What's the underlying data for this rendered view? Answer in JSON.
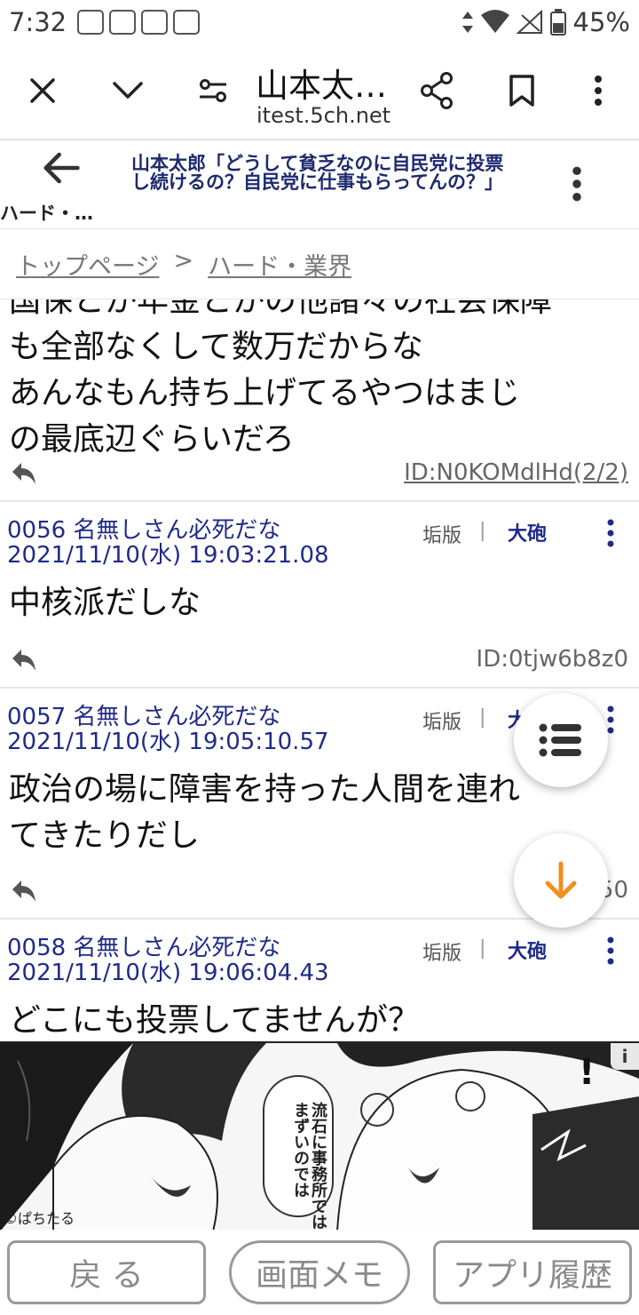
{
  "status_bar": {
    "time": "7:32",
    "battery": "45%"
  },
  "browser": {
    "title": "山本太…",
    "url": "itest.5ch.net"
  },
  "thread_header": {
    "back_label": "ハード・…",
    "title": "山本太郎「どうして貧乏なのに自民党に投票し続けるの？自民党に仕事もらってんの？」"
  },
  "breadcrumb": {
    "top": "トップページ",
    "separator": ">",
    "board": "ハード・業界"
  },
  "posts": [
    {
      "lines": [
        "国保とか年金とかの他諸々の社会保障",
        "も全部なくして数万だからな",
        "あんなもん持ち上げてるやつはまじ",
        "の最底辺ぐらいだろ"
      ],
      "id": "ID:N0KOMdlHd(2/2)"
    },
    {
      "header": "0056 名無しさん必死だな 2021/11/10(水) 19:03:21.08",
      "board": "垢版",
      "separator": "|",
      "tag": "大砲",
      "lines": [
        "中核派だしな"
      ],
      "id": "ID:0tjw6b8z0"
    },
    {
      "header": "0057 名無しさん必死だな 2021/11/10(水) 19:05:10.57",
      "board": "垢版",
      "separator": "|",
      "tag": "大砲",
      "lines": [
        "政治の場に障害を持った人間を連れ",
        "てきたりだし"
      ],
      "id": "ID:3...50"
    },
    {
      "header": "0058 名無しさん必死だな 2021/11/10(水) 19:06:04.43",
      "board": "垢版",
      "separator": "|",
      "tag": "大砲",
      "lines": [
        "どこにも投票してませんが？"
      ]
    }
  ],
  "ad": {
    "info_label": "i",
    "bubble_text": "流石に事務所ではまずいのでは",
    "exclaim": "!",
    "credit": "©ぱちたる"
  },
  "bottom_nav": {
    "back": "戻 る",
    "memo": "画面メモ",
    "history": "アプリ履歴"
  },
  "colors": {
    "accent_orange": "#f0901e",
    "link_navy": "#1f2b88"
  },
  "icons": [
    "close-icon",
    "chevron-down-icon",
    "tune-icon",
    "share-icon",
    "bookmark-icon",
    "more-vert-icon",
    "arrow-back-icon",
    "reply-icon",
    "list-icon",
    "arrow-down-icon"
  ]
}
